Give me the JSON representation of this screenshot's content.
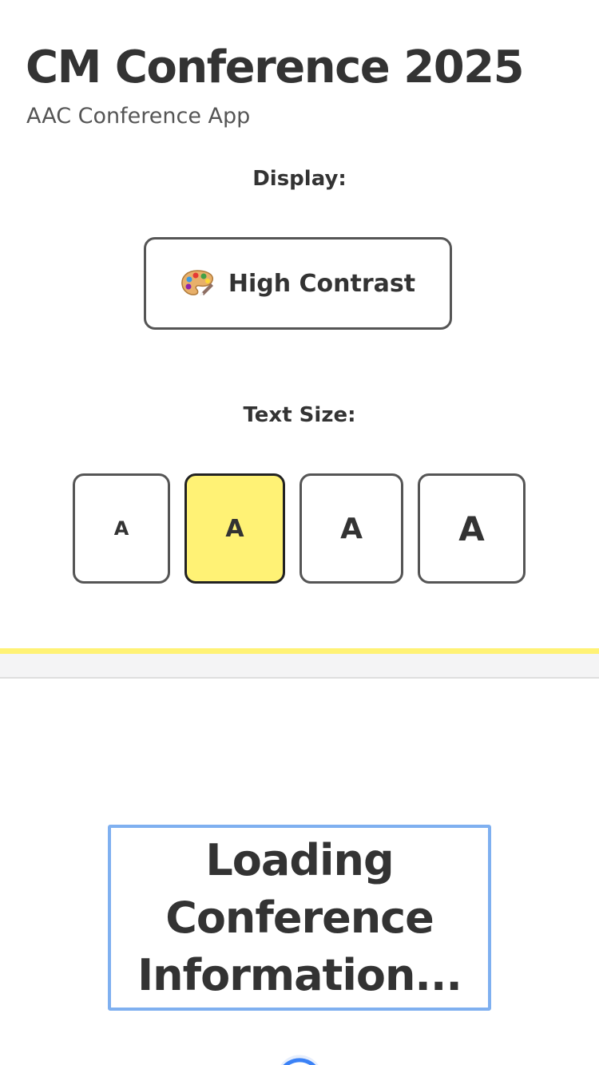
{
  "header": {
    "title": "CM Conference 2025",
    "subtitle": "AAC Conference App"
  },
  "display": {
    "label": "Display:",
    "contrast_button_label": "High Contrast",
    "contrast_icon": "palette-icon"
  },
  "text_size": {
    "label": "Text Size:",
    "options": [
      {
        "label": "A",
        "selected": false
      },
      {
        "label": "A",
        "selected": true
      },
      {
        "label": "A",
        "selected": false
      },
      {
        "label": "A",
        "selected": false
      }
    ]
  },
  "loading": {
    "message": "Loading Conference Information..."
  },
  "colors": {
    "accent_yellow": "#fff275",
    "text_dark": "#333333",
    "loading_border_blue": "#7fb0f0",
    "spinner_blue": "#3b82f6"
  }
}
